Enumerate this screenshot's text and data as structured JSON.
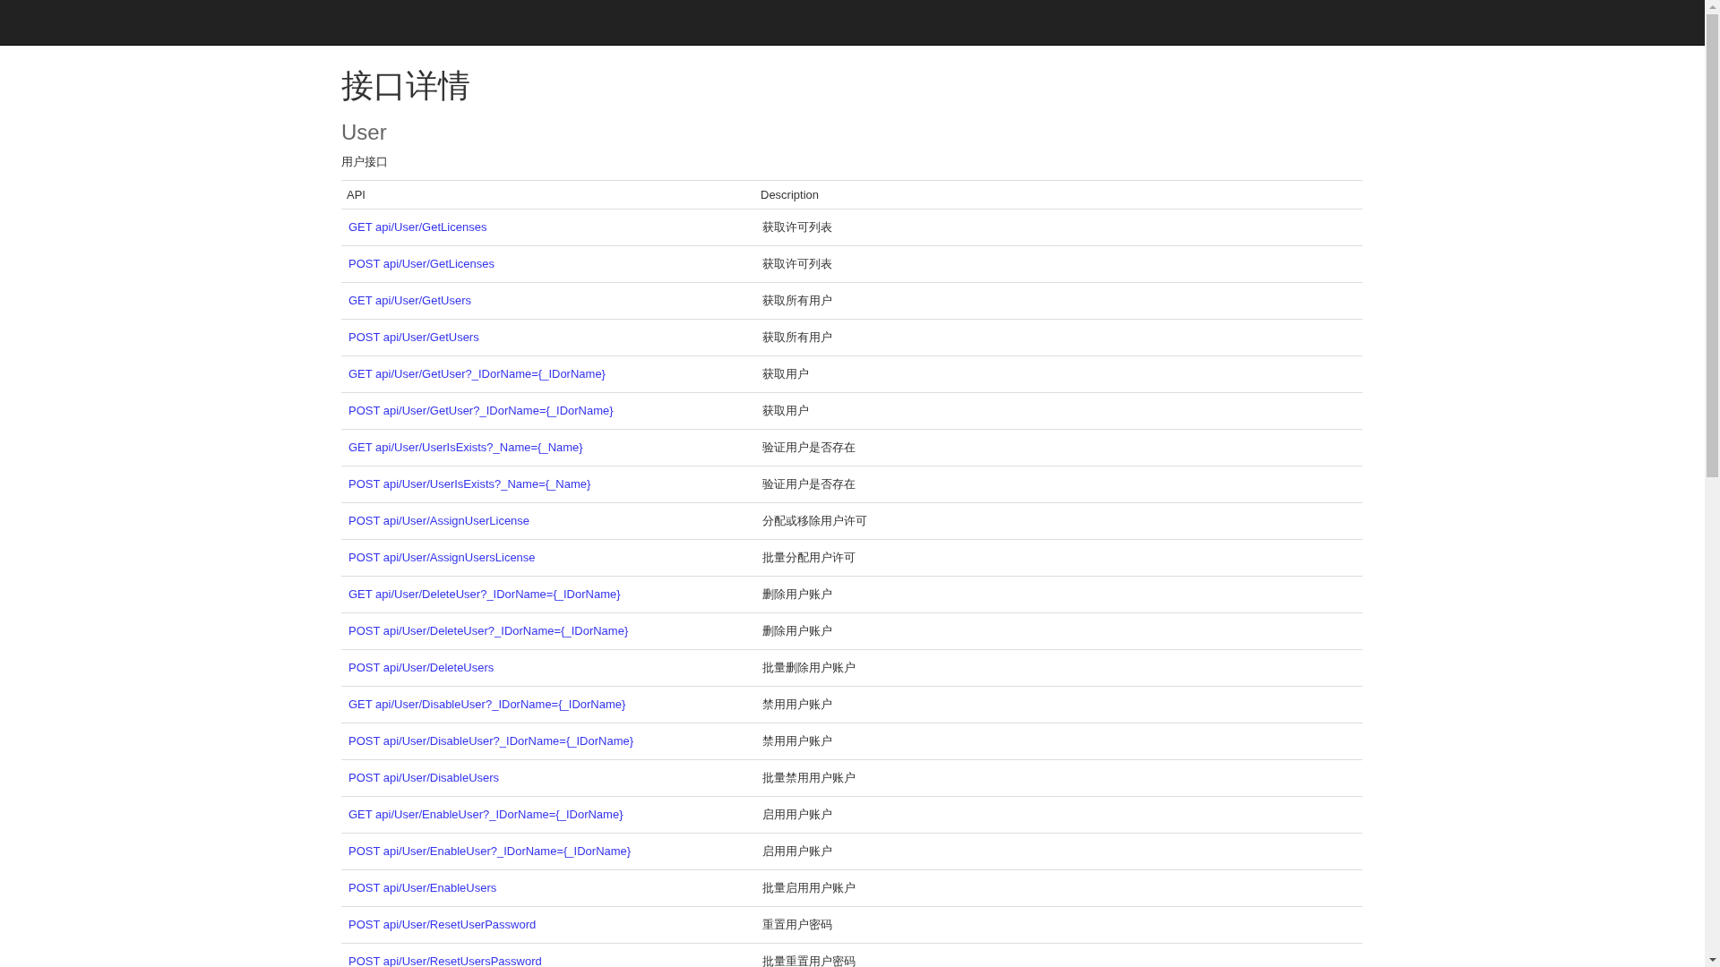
{
  "page": {
    "title": "接口详情"
  },
  "section": {
    "title": "User",
    "subtitle": "用户接口"
  },
  "table": {
    "columns": [
      "API",
      "Description"
    ],
    "rows": [
      {
        "api": "GET api/User/GetLicenses",
        "description": "获取许可列表"
      },
      {
        "api": "POST api/User/GetLicenses",
        "description": "获取许可列表"
      },
      {
        "api": "GET api/User/GetUsers",
        "description": "获取所有用户"
      },
      {
        "api": "POST api/User/GetUsers",
        "description": "获取所有用户"
      },
      {
        "api": "GET api/User/GetUser?_IDorName={_IDorName}",
        "description": "获取用户"
      },
      {
        "api": "POST api/User/GetUser?_IDorName={_IDorName}",
        "description": "获取用户"
      },
      {
        "api": "GET api/User/UserIsExists?_Name={_Name}",
        "description": "验证用户是否存在"
      },
      {
        "api": "POST api/User/UserIsExists?_Name={_Name}",
        "description": "验证用户是否存在"
      },
      {
        "api": "POST api/User/AssignUserLicense",
        "description": "分配或移除用户许可"
      },
      {
        "api": "POST api/User/AssignUsersLicense",
        "description": "批量分配用户许可"
      },
      {
        "api": "GET api/User/DeleteUser?_IDorName={_IDorName}",
        "description": "删除用户账户"
      },
      {
        "api": "POST api/User/DeleteUser?_IDorName={_IDorName}",
        "description": "删除用户账户"
      },
      {
        "api": "POST api/User/DeleteUsers",
        "description": "批量删除用户账户"
      },
      {
        "api": "GET api/User/DisableUser?_IDorName={_IDorName}",
        "description": "禁用用户账户"
      },
      {
        "api": "POST api/User/DisableUser?_IDorName={_IDorName}",
        "description": "禁用用户账户"
      },
      {
        "api": "POST api/User/DisableUsers",
        "description": "批量禁用用户账户"
      },
      {
        "api": "GET api/User/EnableUser?_IDorName={_IDorName}",
        "description": "启用用户账户"
      },
      {
        "api": "POST api/User/EnableUser?_IDorName={_IDorName}",
        "description": "启用用户账户"
      },
      {
        "api": "POST api/User/EnableUsers",
        "description": "批量启用用户账户"
      },
      {
        "api": "POST api/User/ResetUserPassword",
        "description": "重置用户密码"
      },
      {
        "api": "POST api/User/ResetUsersPassword",
        "description": "批量重置用户密码"
      }
    ]
  }
}
